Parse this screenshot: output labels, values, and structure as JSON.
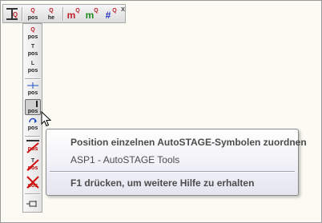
{
  "icon_glyphs": {
    "pos_label": "pos",
    "sym_q": "Q",
    "sym_t": "T",
    "sym_l": "L",
    "sym_hash": "#",
    "sym_m": "m",
    "sym_he": "he"
  },
  "toolbar": {
    "buttons": [
      {
        "name": "label-q-icon"
      },
      {
        "name": "pos-q-icon"
      },
      {
        "name": "pos-q-label-icon"
      },
      {
        "name": "m-red-q-icon"
      },
      {
        "name": "m-green-q-icon"
      },
      {
        "name": "hash-q-icon"
      }
    ],
    "close": "x"
  },
  "dropdown": {
    "items": [
      {
        "name": "pos-q-icon"
      },
      {
        "name": "pos-t-icon"
      },
      {
        "name": "pos-l-icon"
      },
      {
        "name": "pos-move-icon"
      },
      {
        "name": "pos-assign-icon",
        "pressed": true
      },
      {
        "name": "pos-rotate-icon"
      },
      {
        "name": "pos-delete-icon"
      },
      {
        "name": "pos-delete2-icon"
      },
      {
        "name": "pos-delete3-icon"
      },
      {
        "name": "pin-icon"
      }
    ]
  },
  "tooltip": {
    "title": "Position einzelnen AutoSTAGE-Symbolen zuordnen",
    "subtitle": "ASP1 - AutoSTAGE Tools",
    "help": "F1 drücken, um weitere Hilfe zu erhalten"
  }
}
